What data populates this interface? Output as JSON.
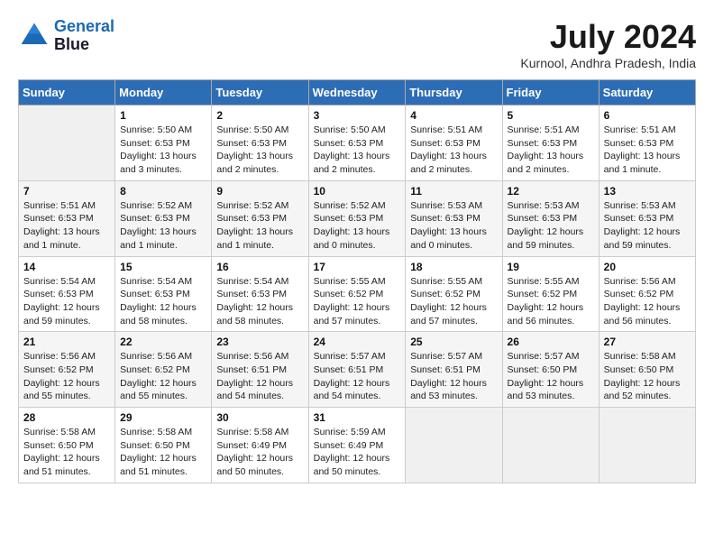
{
  "header": {
    "logo_line1": "General",
    "logo_line2": "Blue",
    "title": "July 2024",
    "location": "Kurnool, Andhra Pradesh, India"
  },
  "columns": [
    "Sunday",
    "Monday",
    "Tuesday",
    "Wednesday",
    "Thursday",
    "Friday",
    "Saturday"
  ],
  "weeks": [
    [
      {
        "day": "",
        "sunrise": "",
        "sunset": "",
        "daylight": "",
        "empty": true
      },
      {
        "day": "1",
        "sunrise": "Sunrise: 5:50 AM",
        "sunset": "Sunset: 6:53 PM",
        "daylight": "Daylight: 13 hours and 3 minutes."
      },
      {
        "day": "2",
        "sunrise": "Sunrise: 5:50 AM",
        "sunset": "Sunset: 6:53 PM",
        "daylight": "Daylight: 13 hours and 2 minutes."
      },
      {
        "day": "3",
        "sunrise": "Sunrise: 5:50 AM",
        "sunset": "Sunset: 6:53 PM",
        "daylight": "Daylight: 13 hours and 2 minutes."
      },
      {
        "day": "4",
        "sunrise": "Sunrise: 5:51 AM",
        "sunset": "Sunset: 6:53 PM",
        "daylight": "Daylight: 13 hours and 2 minutes."
      },
      {
        "day": "5",
        "sunrise": "Sunrise: 5:51 AM",
        "sunset": "Sunset: 6:53 PM",
        "daylight": "Daylight: 13 hours and 2 minutes."
      },
      {
        "day": "6",
        "sunrise": "Sunrise: 5:51 AM",
        "sunset": "Sunset: 6:53 PM",
        "daylight": "Daylight: 13 hours and 1 minute."
      }
    ],
    [
      {
        "day": "7",
        "sunrise": "Sunrise: 5:51 AM",
        "sunset": "Sunset: 6:53 PM",
        "daylight": "Daylight: 13 hours and 1 minute."
      },
      {
        "day": "8",
        "sunrise": "Sunrise: 5:52 AM",
        "sunset": "Sunset: 6:53 PM",
        "daylight": "Daylight: 13 hours and 1 minute."
      },
      {
        "day": "9",
        "sunrise": "Sunrise: 5:52 AM",
        "sunset": "Sunset: 6:53 PM",
        "daylight": "Daylight: 13 hours and 1 minute."
      },
      {
        "day": "10",
        "sunrise": "Sunrise: 5:52 AM",
        "sunset": "Sunset: 6:53 PM",
        "daylight": "Daylight: 13 hours and 0 minutes."
      },
      {
        "day": "11",
        "sunrise": "Sunrise: 5:53 AM",
        "sunset": "Sunset: 6:53 PM",
        "daylight": "Daylight: 13 hours and 0 minutes."
      },
      {
        "day": "12",
        "sunrise": "Sunrise: 5:53 AM",
        "sunset": "Sunset: 6:53 PM",
        "daylight": "Daylight: 12 hours and 59 minutes."
      },
      {
        "day": "13",
        "sunrise": "Sunrise: 5:53 AM",
        "sunset": "Sunset: 6:53 PM",
        "daylight": "Daylight: 12 hours and 59 minutes."
      }
    ],
    [
      {
        "day": "14",
        "sunrise": "Sunrise: 5:54 AM",
        "sunset": "Sunset: 6:53 PM",
        "daylight": "Daylight: 12 hours and 59 minutes."
      },
      {
        "day": "15",
        "sunrise": "Sunrise: 5:54 AM",
        "sunset": "Sunset: 6:53 PM",
        "daylight": "Daylight: 12 hours and 58 minutes."
      },
      {
        "day": "16",
        "sunrise": "Sunrise: 5:54 AM",
        "sunset": "Sunset: 6:53 PM",
        "daylight": "Daylight: 12 hours and 58 minutes."
      },
      {
        "day": "17",
        "sunrise": "Sunrise: 5:55 AM",
        "sunset": "Sunset: 6:52 PM",
        "daylight": "Daylight: 12 hours and 57 minutes."
      },
      {
        "day": "18",
        "sunrise": "Sunrise: 5:55 AM",
        "sunset": "Sunset: 6:52 PM",
        "daylight": "Daylight: 12 hours and 57 minutes."
      },
      {
        "day": "19",
        "sunrise": "Sunrise: 5:55 AM",
        "sunset": "Sunset: 6:52 PM",
        "daylight": "Daylight: 12 hours and 56 minutes."
      },
      {
        "day": "20",
        "sunrise": "Sunrise: 5:56 AM",
        "sunset": "Sunset: 6:52 PM",
        "daylight": "Daylight: 12 hours and 56 minutes."
      }
    ],
    [
      {
        "day": "21",
        "sunrise": "Sunrise: 5:56 AM",
        "sunset": "Sunset: 6:52 PM",
        "daylight": "Daylight: 12 hours and 55 minutes."
      },
      {
        "day": "22",
        "sunrise": "Sunrise: 5:56 AM",
        "sunset": "Sunset: 6:52 PM",
        "daylight": "Daylight: 12 hours and 55 minutes."
      },
      {
        "day": "23",
        "sunrise": "Sunrise: 5:56 AM",
        "sunset": "Sunset: 6:51 PM",
        "daylight": "Daylight: 12 hours and 54 minutes."
      },
      {
        "day": "24",
        "sunrise": "Sunrise: 5:57 AM",
        "sunset": "Sunset: 6:51 PM",
        "daylight": "Daylight: 12 hours and 54 minutes."
      },
      {
        "day": "25",
        "sunrise": "Sunrise: 5:57 AM",
        "sunset": "Sunset: 6:51 PM",
        "daylight": "Daylight: 12 hours and 53 minutes."
      },
      {
        "day": "26",
        "sunrise": "Sunrise: 5:57 AM",
        "sunset": "Sunset: 6:50 PM",
        "daylight": "Daylight: 12 hours and 53 minutes."
      },
      {
        "day": "27",
        "sunrise": "Sunrise: 5:58 AM",
        "sunset": "Sunset: 6:50 PM",
        "daylight": "Daylight: 12 hours and 52 minutes."
      }
    ],
    [
      {
        "day": "28",
        "sunrise": "Sunrise: 5:58 AM",
        "sunset": "Sunset: 6:50 PM",
        "daylight": "Daylight: 12 hours and 51 minutes."
      },
      {
        "day": "29",
        "sunrise": "Sunrise: 5:58 AM",
        "sunset": "Sunset: 6:50 PM",
        "daylight": "Daylight: 12 hours and 51 minutes."
      },
      {
        "day": "30",
        "sunrise": "Sunrise: 5:58 AM",
        "sunset": "Sunset: 6:49 PM",
        "daylight": "Daylight: 12 hours and 50 minutes."
      },
      {
        "day": "31",
        "sunrise": "Sunrise: 5:59 AM",
        "sunset": "Sunset: 6:49 PM",
        "daylight": "Daylight: 12 hours and 50 minutes."
      },
      {
        "day": "",
        "sunrise": "",
        "sunset": "",
        "daylight": "",
        "empty": true
      },
      {
        "day": "",
        "sunrise": "",
        "sunset": "",
        "daylight": "",
        "empty": true
      },
      {
        "day": "",
        "sunrise": "",
        "sunset": "",
        "daylight": "",
        "empty": true
      }
    ]
  ]
}
